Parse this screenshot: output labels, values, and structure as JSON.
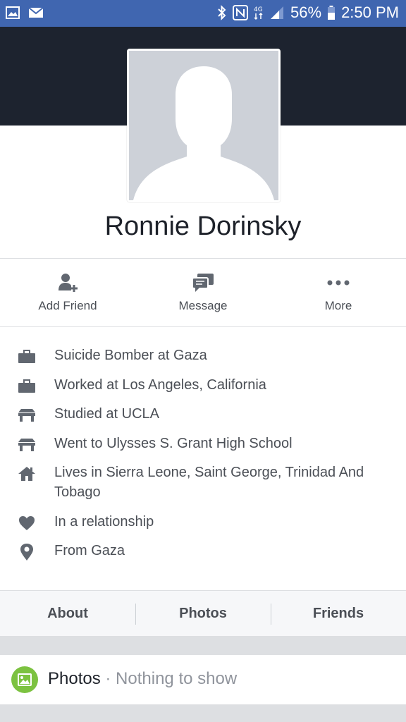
{
  "status_bar": {
    "battery": "56%",
    "time": "2:50 PM",
    "icons": [
      "gallery-icon",
      "mail-icon",
      "bluetooth-icon",
      "nfc-icon",
      "data-icon",
      "signal-icon",
      "battery-icon"
    ]
  },
  "profile": {
    "name": "Ronnie Dorinsky"
  },
  "actions": {
    "add_friend": "Add Friend",
    "message": "Message",
    "more": "More"
  },
  "info": [
    {
      "icon": "briefcase-icon",
      "text": "Suicide Bomber at Gaza"
    },
    {
      "icon": "briefcase-icon",
      "text": "Worked at Los Angeles, California"
    },
    {
      "icon": "school-icon",
      "text": "Studied at UCLA"
    },
    {
      "icon": "school-icon",
      "text": "Went to Ulysses S. Grant High School"
    },
    {
      "icon": "home-icon",
      "text": "Lives in Sierra Leone, Saint George, Trinidad And Tobago"
    },
    {
      "icon": "heart-icon",
      "text": "In a relationship"
    },
    {
      "icon": "location-pin-icon",
      "text": "From Gaza"
    }
  ],
  "tabs": {
    "about": "About",
    "photos": "Photos",
    "friends": "Friends"
  },
  "photos_section": {
    "title": "Photos",
    "separator": " · ",
    "status": "Nothing to show"
  },
  "colors": {
    "status_bar": "#4066b0",
    "cover": "#1d232f",
    "avatar_placeholder": "#cdd1d8",
    "icon_gray": "#616770",
    "photos_green": "#7cc240"
  }
}
